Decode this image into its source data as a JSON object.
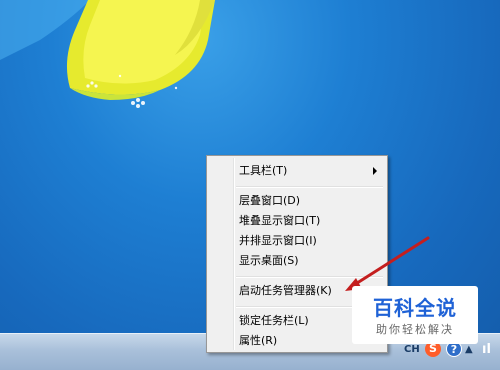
{
  "menu": {
    "toolbars": "工具栏(T)",
    "cascade": "层叠窗口(D)",
    "stacked": "堆叠显示窗口(T)",
    "side_by_side": "并排显示窗口(I)",
    "show_desktop": "显示桌面(S)",
    "task_manager": "启动任务管理器(K)",
    "lock_taskbar": "锁定任务栏(L)",
    "properties": "属性(R)"
  },
  "watermark": {
    "title": "百科全说",
    "subtitle": "助你轻松解决"
  },
  "tray": {
    "language": "CH",
    "sogou": "S",
    "help": "?",
    "more": "▲",
    "flag": "ıl"
  },
  "colors": {
    "desktop": "#1e7fd3",
    "menu_bg": "#f0f0f0",
    "arrow": "#c41e1e",
    "watermark_blue": "#1f62d6"
  }
}
